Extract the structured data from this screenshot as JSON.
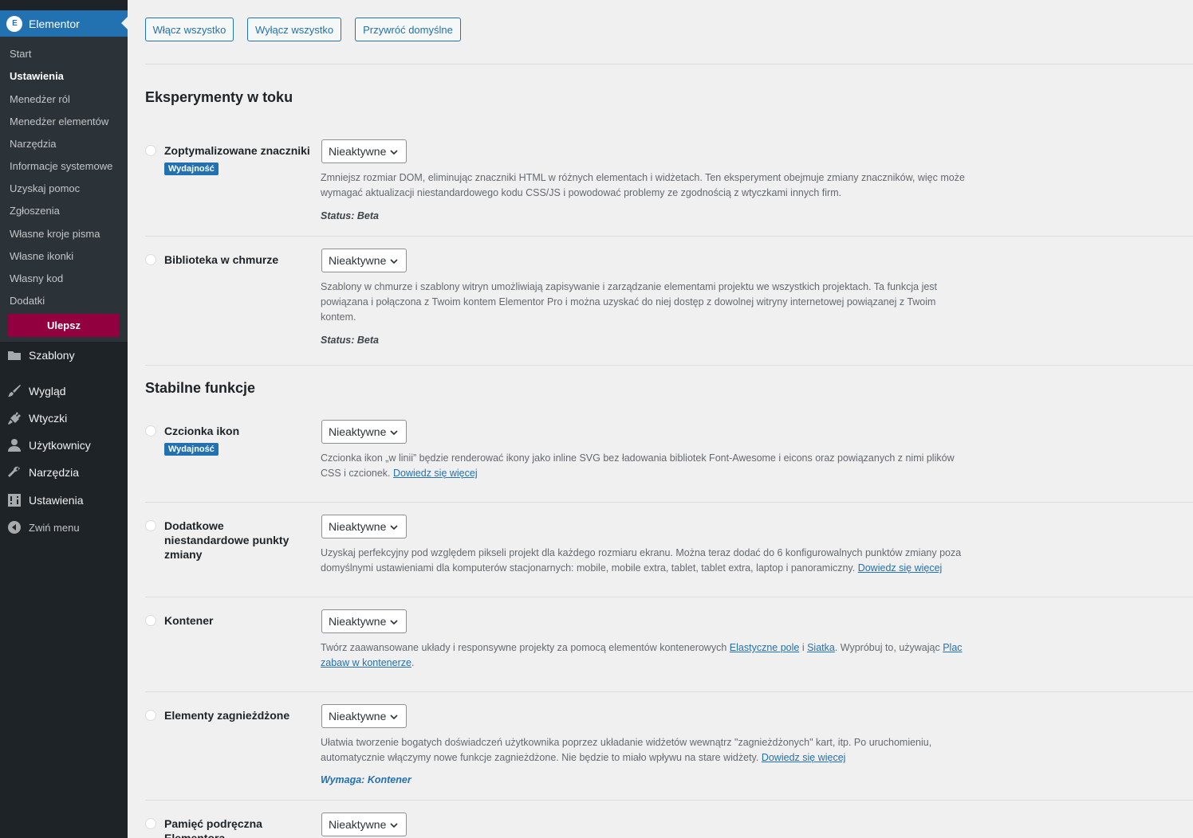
{
  "sidebar": {
    "plugin": {
      "logo": "E",
      "title": "Elementor"
    },
    "submenu": [
      "Start",
      "Ustawienia",
      "Menedżer ról",
      "Menedżer elementów",
      "Narzędzia",
      "Informacje systemowe",
      "Uzyskaj pomoc",
      "Zgłoszenia",
      "Własne kroje pisma",
      "Własne ikonki",
      "Własny kod",
      "Dodatki"
    ],
    "upgrade_label": "Ulepsz",
    "menu": [
      {
        "label": "Szablony",
        "icon": "folder-icon"
      },
      {
        "label": "Wygląd",
        "icon": "paintbrush-icon"
      },
      {
        "label": "Wtyczki",
        "icon": "plugin-icon"
      },
      {
        "label": "Użytkownicy",
        "icon": "users-icon"
      },
      {
        "label": "Narzędzia",
        "icon": "wrench-icon"
      },
      {
        "label": "Ustawienia",
        "icon": "settings-icon"
      },
      {
        "label": "Zwiń menu",
        "icon": "collapse-icon"
      }
    ]
  },
  "toolbar": {
    "enable_all": "Włącz wszystko",
    "disable_all": "Wyłącz wszystko",
    "restore_defaults": "Przywróć domyślne"
  },
  "sections": {
    "ongoing": "Eksperymenty w toku",
    "stable": "Stabilne funkcje"
  },
  "select_value": "Nieaktywne",
  "experiments": [
    {
      "name": "Zoptymalizowane znaczniki",
      "tag": "Wydajność",
      "desc": "Zmniejsz rozmiar DOM, eliminując znaczniki HTML w różnych elementach i widżetach. Ten eksperyment obejmuje zmiany znaczników, więc może wymagać aktualizacji niestandardowego kodu CSS/JS i powodować problemy ze zgodnością z wtyczkami innych firm.",
      "status": "Status: Beta"
    },
    {
      "name": "Biblioteka w chmurze",
      "desc": "Szablony w chmurze i szablony witryn umożliwiają zapisywanie i zarządzanie elementami projektu we wszystkich projektach. Ta funkcja jest powiązana i połączona z Twoim kontem Elementor Pro i można uzyskać do niej dostęp z dowolnej witryny internetowej powiązanej z Twoim kontem.",
      "status": "Status: Beta"
    },
    {
      "name": "Czcionka ikon",
      "tag": "Wydajność",
      "desc": "Czcionka ikon „w linii” będzie renderować ikony jako inline SVG bez ładowania bibliotek Font-Awesome i eicons oraz powiązanych z nimi plików CSS i czcionek.",
      "link": "Dowiedz się więcej"
    },
    {
      "name": "Dodatkowe niestandardowe punkty zmiany",
      "desc": "Uzyskaj perfekcyjny pod względem pikseli projekt dla każdego rozmiaru ekranu. Można teraz dodać do 6 konfigurowalnych punktów zmiany poza domyślnymi ustawieniami dla komputerów stacjonarnych: mobile, mobile extra, tablet, tablet extra, laptop i panoramiczny.",
      "link": "Dowiedz się więcej"
    },
    {
      "name": "Kontener",
      "desc_a": "Twórz zaawansowane układy i responsywne projekty za pomocą elementów kontenerowych",
      "link_a": "Elastyczne pole",
      "desc_b": "i",
      "link_b": "Siatka",
      "desc_c": ". Wypróbuj to, używając",
      "link_c": "Plac zabaw w kontenerze",
      "desc_d": "."
    },
    {
      "name": "Elementy zagnieżdżone",
      "desc": "Ułatwia tworzenie bogatych doświadczeń użytkownika poprzez układanie widżetów wewnątrz \"zagnieżdżonych\" kart, itp. Po uruchomieniu, automatycznie włączymy nowe funkcje zagnieżdżone. Nie będzie to miało wpływu na stare widżety.",
      "link": "Dowiedz się więcej",
      "requires": "Wymaga: Kontener"
    },
    {
      "name": "Pamięć podręczna Elementora"
    }
  ]
}
